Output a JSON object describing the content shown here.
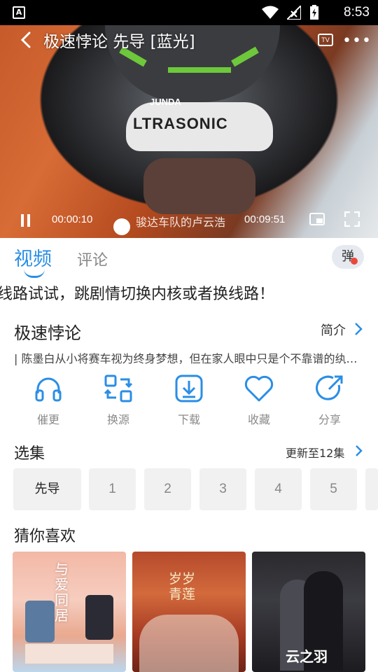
{
  "status_bar": {
    "time": "8:53",
    "left_icon": "A"
  },
  "player": {
    "title": "极速悖论 先导 [蓝光]",
    "helmet_text": "LTRASONIC",
    "helmet_text_top": "JUNDA",
    "tv_label": "TV",
    "more": "•••",
    "current_time": "00:00:10",
    "duration": "00:09:51",
    "caption": "骏达车队的卢云浩"
  },
  "tabs": {
    "video": "视频",
    "comment": "评论",
    "danmaku": "弹"
  },
  "marquee": "线路试试，跳剧情切换内核或者换线路！",
  "show": {
    "title": "极速悖论",
    "intro_label": "简介",
    "description": "| 陈墨白从小将赛车视为终身梦想，但在家人眼中只是个不靠谱的纨绔子弟"
  },
  "actions": [
    {
      "label": "催更",
      "icon": "headphones-icon"
    },
    {
      "label": "换源",
      "icon": "switch-source-icon"
    },
    {
      "label": "下载",
      "icon": "download-icon"
    },
    {
      "label": "收藏",
      "icon": "heart-icon"
    },
    {
      "label": "分享",
      "icon": "share-icon"
    }
  ],
  "episodes": {
    "title": "选集",
    "update_label": "更新至12集",
    "items": [
      "先导",
      "1",
      "2",
      "3",
      "4",
      "5"
    ]
  },
  "recommendations": {
    "title": "猜你喜欢",
    "posters": [
      {
        "text": "与\n爱\n同\n居"
      },
      {
        "text": "岁岁\n青莲"
      },
      {
        "text": "云之羽"
      }
    ]
  },
  "colors": {
    "accent": "#2a8ee5",
    "danmaku_dot": "#e9493b"
  }
}
